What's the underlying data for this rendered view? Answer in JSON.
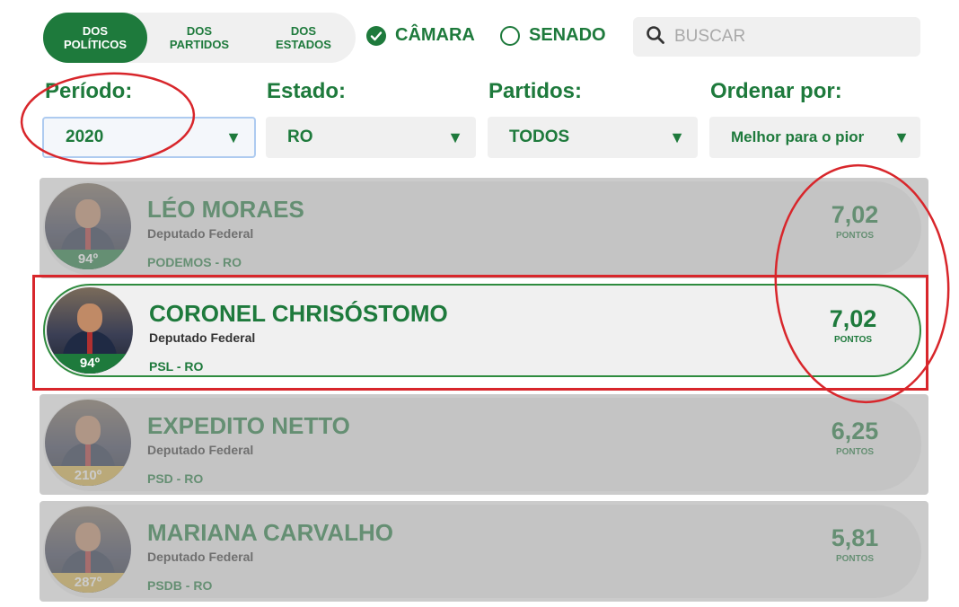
{
  "tabs": [
    {
      "label": "DOS\nPOLÍTICOS",
      "active": true
    },
    {
      "label": "DOS\nPARTIDOS",
      "active": false
    },
    {
      "label": "DOS\nESTADOS",
      "active": false
    }
  ],
  "chambers": [
    {
      "label": "CÂMARA",
      "checked": true
    },
    {
      "label": "SENADO",
      "checked": false
    }
  ],
  "search": {
    "placeholder": "BUSCAR",
    "icon": "search-icon"
  },
  "filters": {
    "periodo": {
      "label": "Período:",
      "value": "2020"
    },
    "estado": {
      "label": "Estado:",
      "value": "RO"
    },
    "partidos": {
      "label": "Partidos:",
      "value": "TODOS"
    },
    "ordenar": {
      "label": "Ordenar por:",
      "value": "Melhor para o pior"
    }
  },
  "politicians": [
    {
      "name": "LÉO MORAES",
      "role": "Deputado Federal",
      "party": "PODEMOS - RO",
      "rank": "94º",
      "score": "7,02",
      "score_unit": "PONTOS"
    },
    {
      "name": "CORONEL CHRISÓSTOMO",
      "role": "Deputado Federal",
      "party": "PSL - RO",
      "rank": "94º",
      "score": "7,02",
      "score_unit": "PONTOS"
    },
    {
      "name": "EXPEDITO NETTO",
      "role": "Deputado Federal",
      "party": "PSD - RO",
      "rank": "210º",
      "score": "6,25",
      "score_unit": "PONTOS"
    },
    {
      "name": "MARIANA CARVALHO",
      "role": "Deputado Federal",
      "party": "PSDB - RO",
      "rank": "287º",
      "score": "5,81",
      "score_unit": "PONTOS"
    }
  ],
  "colors": {
    "brand_green": "#1e7a3c",
    "annotation_red": "#d8262b",
    "rank_gold": "#d9b44a"
  }
}
